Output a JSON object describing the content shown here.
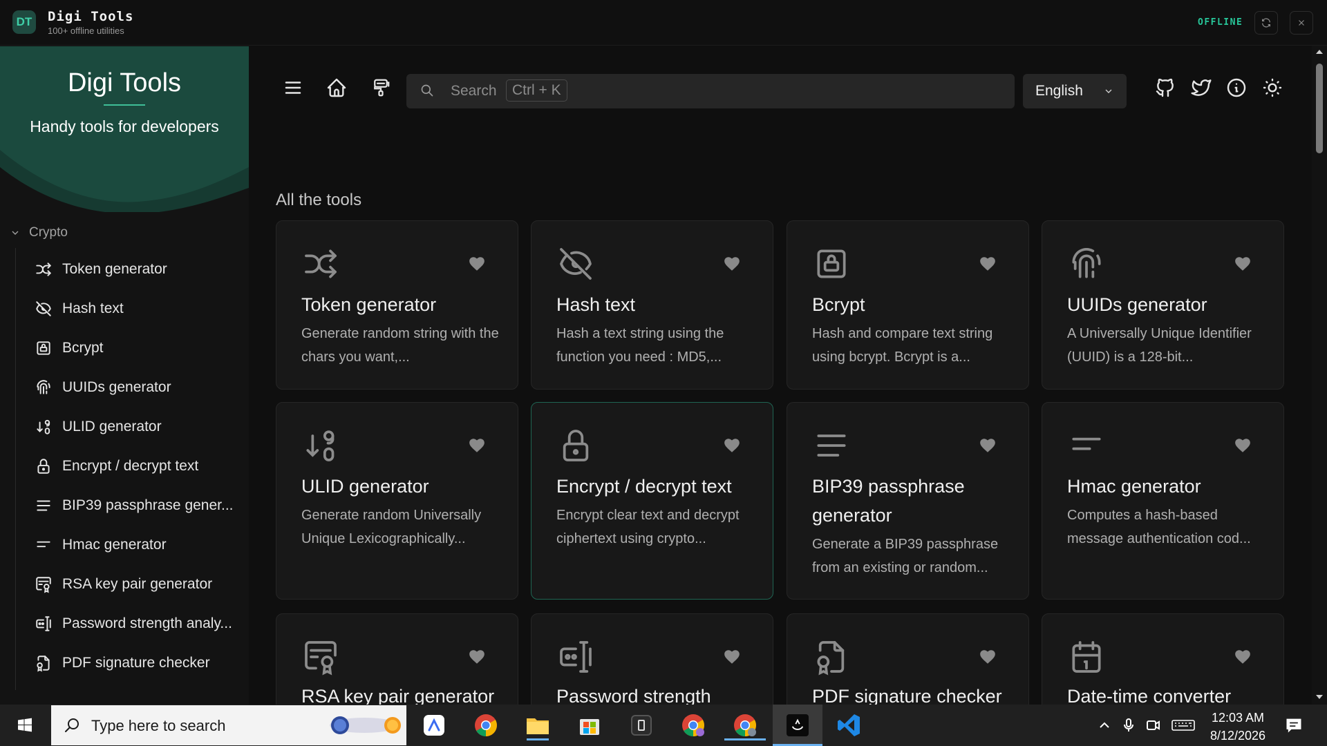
{
  "titlebar": {
    "logo_text": "DT",
    "title": "Digi Tools",
    "subtitle": "100+ offline utilities",
    "status": "OFFLINE"
  },
  "sidebar": {
    "hero_title": "Digi Tools",
    "hero_tagline": "Handy tools for developers",
    "section": "Crypto",
    "items": [
      {
        "label": "Token generator",
        "icon": "shuffle-icon"
      },
      {
        "label": "Hash text",
        "icon": "eye-off-icon"
      },
      {
        "label": "Bcrypt",
        "icon": "lock-square-icon"
      },
      {
        "label": "UUIDs generator",
        "icon": "fingerprint-icon"
      },
      {
        "label": "ULID generator",
        "icon": "sort-numeric-icon"
      },
      {
        "label": "Encrypt / decrypt text",
        "icon": "lock-icon"
      },
      {
        "label": "BIP39 passphrase gener...",
        "icon": "lines-icon"
      },
      {
        "label": "Hmac generator",
        "icon": "short-lines-icon"
      },
      {
        "label": "RSA key pair generator",
        "icon": "certificate-icon"
      },
      {
        "label": "Password strength analy...",
        "icon": "password-icon"
      },
      {
        "label": "PDF signature checker",
        "icon": "file-certificate-icon"
      }
    ]
  },
  "header": {
    "search_placeholder": "Search",
    "search_shortcut": "Ctrl + K",
    "language": "English",
    "icons": [
      "menu-icon",
      "home-icon",
      "paint-icon",
      "github-icon",
      "twitter-icon",
      "info-icon",
      "sun-icon"
    ]
  },
  "main": {
    "section_title": "All the tools",
    "cards": [
      {
        "title": "Token generator",
        "desc": "Generate random string with the chars you want,...",
        "icon": "shuffle-icon"
      },
      {
        "title": "Hash text",
        "desc": "Hash a text string using the function you need : MD5,...",
        "icon": "eye-off-icon"
      },
      {
        "title": "Bcrypt",
        "desc": "Hash and compare text string using bcrypt. Bcrypt is a...",
        "icon": "lock-square-icon"
      },
      {
        "title": "UUIDs generator",
        "desc": "A Universally Unique Identifier (UUID) is a 128-bit...",
        "icon": "fingerprint-icon"
      },
      {
        "title": "ULID generator",
        "desc": "Generate random Universally Unique Lexicographically...",
        "icon": "sort-numeric-icon"
      },
      {
        "title": "Encrypt / decrypt text",
        "desc": "Encrypt clear text and decrypt ciphertext using crypto...",
        "icon": "lock-icon"
      },
      {
        "title": "BIP39 passphrase generator",
        "desc": "Generate a BIP39 passphrase from an existing or random...",
        "icon": "lines-icon"
      },
      {
        "title": "Hmac generator",
        "desc": "Computes a hash-based message authentication cod...",
        "icon": "short-lines-icon"
      },
      {
        "title": "RSA key pair generator",
        "desc": "",
        "icon": "certificate-icon"
      },
      {
        "title": "Password strength",
        "desc": "",
        "icon": "password-icon"
      },
      {
        "title": "PDF signature checker",
        "desc": "",
        "icon": "file-certificate-icon"
      },
      {
        "title": "Date-time converter",
        "desc": "",
        "icon": "calendar-icon"
      }
    ]
  },
  "taskbar": {
    "search_placeholder": "Type here to search",
    "time": "12:03 AM",
    "date": "8/12/2026"
  },
  "colors": {
    "accent": "#28c79a",
    "hero": "#1b4a3e",
    "background": "#0f0f0f",
    "card": "#181818"
  }
}
